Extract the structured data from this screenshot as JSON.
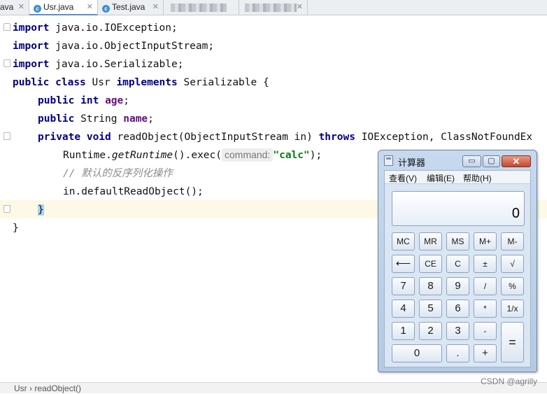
{
  "tabs": [
    {
      "label": "ava",
      "icon": "close-icon"
    },
    {
      "label": "Usr.java",
      "icon": "java-class-icon",
      "active": true
    },
    {
      "label": "Test.java",
      "icon": "java-class-icon"
    }
  ],
  "code": {
    "l1": {
      "kw": "import",
      "rest": " java.io.IOException;"
    },
    "l2": {
      "kw": "import",
      "rest": " java.io.ObjectInputStream;"
    },
    "l3": {
      "kw": "import",
      "rest": " java.io.Serializable;"
    },
    "l4": {
      "kw1": "public",
      "kw2": "class",
      "name": " Usr ",
      "kw3": "implements",
      "rest": " Serializable {"
    },
    "l5": {
      "kw1": "public",
      "kw2": "int",
      "field": "age",
      "end": ";"
    },
    "l6": {
      "kw1": "public",
      "type": " String ",
      "field": "name",
      "end": ";"
    },
    "l7": {
      "kw1": "private",
      "kw2": "void",
      "mid": " readObject(ObjectInputStream in) ",
      "kw3": "throws",
      "rest": " IOException, ClassNotFoundEx"
    },
    "l8": {
      "pre": "Runtime.",
      "method": "getRuntime",
      "mid": "().exec(",
      "hint": "command:",
      "str": "\"calc\"",
      "end": ");"
    },
    "l9": {
      "comment": "// 默认的反序列化操作"
    },
    "l10": {
      "text": "in.defaultReadObject();"
    },
    "l11": {
      "brace": "}"
    },
    "l12": {
      "brace": "}"
    }
  },
  "status": {
    "breadcrumb": "Usr  ›  readObject()"
  },
  "watermark": "CSDN @agrilly",
  "calculator": {
    "title": "计算器",
    "menu": [
      "查看(V)",
      "编辑(E)",
      "帮助(H)"
    ],
    "display": "0",
    "window_buttons": {
      "minimize": "▭",
      "maximize": "▢",
      "close": "✕"
    },
    "buttons": {
      "r1": [
        "MC",
        "MR",
        "MS",
        "M+",
        "M-"
      ],
      "r2": [
        "⟵",
        "CE",
        "C",
        "±",
        "√"
      ],
      "r3": [
        "7",
        "8",
        "9",
        "/",
        "%"
      ],
      "r4": [
        "4",
        "5",
        "6",
        "*",
        "1/x"
      ],
      "r5": [
        "1",
        "2",
        "3",
        "-"
      ],
      "r6": [
        "0",
        ".",
        "+"
      ],
      "equals": "="
    }
  }
}
